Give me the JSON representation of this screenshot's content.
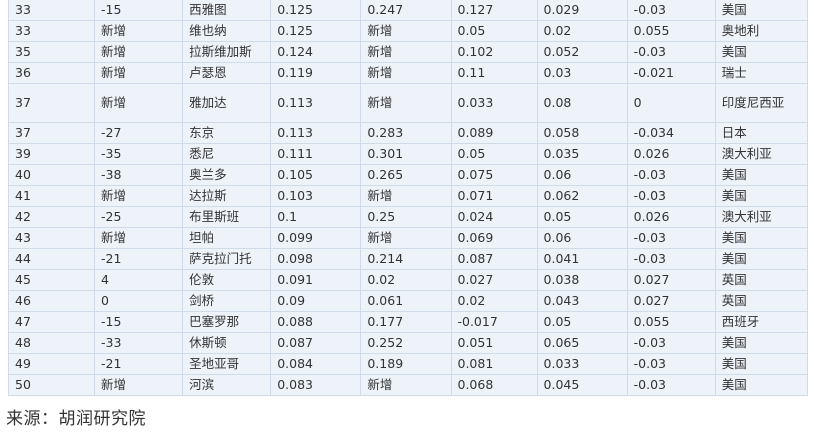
{
  "table": {
    "rows": [
      {
        "rank": "33",
        "change": "-15",
        "city": "西雅图",
        "v1": "0.125",
        "v2": "0.247",
        "v3": "0.127",
        "v4": "0.029",
        "v5": "-0.03",
        "country": "美国"
      },
      {
        "rank": "33",
        "change": "新增",
        "city": "维也纳",
        "v1": "0.125",
        "v2": "新增",
        "v3": "0.05",
        "v4": "0.02",
        "v5": "0.055",
        "country": "奥地利"
      },
      {
        "rank": "35",
        "change": "新增",
        "city": "拉斯维加斯",
        "v1": "0.124",
        "v2": "新增",
        "v3": "0.102",
        "v4": "0.052",
        "v5": "-0.03",
        "country": "美国"
      },
      {
        "rank": "36",
        "change": "新增",
        "city": "卢瑟恩",
        "v1": "0.119",
        "v2": "新增",
        "v3": "0.11",
        "v4": "0.03",
        "v5": "-0.021",
        "country": "瑞士"
      },
      {
        "rank": "37",
        "change": "新增",
        "city": "雅加达",
        "v1": "0.113",
        "v2": "新增",
        "v3": "0.033",
        "v4": "0.08",
        "v5": "0",
        "country": "印度尼西亚"
      },
      {
        "rank": "37",
        "change": "-27",
        "city": "东京",
        "v1": "0.113",
        "v2": "0.283",
        "v3": "0.089",
        "v4": "0.058",
        "v5": "-0.034",
        "country": "日本"
      },
      {
        "rank": "39",
        "change": "-35",
        "city": "悉尼",
        "v1": "0.111",
        "v2": "0.301",
        "v3": "0.05",
        "v4": "0.035",
        "v5": "0.026",
        "country": "澳大利亚"
      },
      {
        "rank": "40",
        "change": "-38",
        "city": "奥兰多",
        "v1": "0.105",
        "v2": "0.265",
        "v3": "0.075",
        "v4": "0.06",
        "v5": "-0.03",
        "country": "美国"
      },
      {
        "rank": "41",
        "change": "新增",
        "city": "达拉斯",
        "v1": "0.103",
        "v2": "新增",
        "v3": "0.071",
        "v4": "0.062",
        "v5": "-0.03",
        "country": "美国"
      },
      {
        "rank": "42",
        "change": "-25",
        "city": "布里斯班",
        "v1": "0.1",
        "v2": "0.25",
        "v3": "0.024",
        "v4": "0.05",
        "v5": "0.026",
        "country": "澳大利亚"
      },
      {
        "rank": "43",
        "change": "新增",
        "city": "坦帕",
        "v1": "0.099",
        "v2": "新增",
        "v3": "0.069",
        "v4": "0.06",
        "v5": "-0.03",
        "country": "美国"
      },
      {
        "rank": "44",
        "change": "-21",
        "city": "萨克拉门托",
        "v1": "0.098",
        "v2": "0.214",
        "v3": "0.087",
        "v4": "0.041",
        "v5": "-0.03",
        "country": "美国"
      },
      {
        "rank": "45",
        "change": "4",
        "city": "伦敦",
        "v1": "0.091",
        "v2": "0.02",
        "v3": "0.027",
        "v4": "0.038",
        "v5": "0.027",
        "country": "英国"
      },
      {
        "rank": "46",
        "change": "0",
        "city": "剑桥",
        "v1": "0.09",
        "v2": "0.061",
        "v3": "0.02",
        "v4": "0.043",
        "v5": "0.027",
        "country": "英国"
      },
      {
        "rank": "47",
        "change": "-15",
        "city": "巴塞罗那",
        "v1": "0.088",
        "v2": "0.177",
        "v3": "-0.017",
        "v4": "0.05",
        "v5": "0.055",
        "country": "西班牙"
      },
      {
        "rank": "48",
        "change": "-33",
        "city": "休斯顿",
        "v1": "0.087",
        "v2": "0.252",
        "v3": "0.051",
        "v4": "0.065",
        "v5": "-0.03",
        "country": "美国"
      },
      {
        "rank": "49",
        "change": "-21",
        "city": "圣地亚哥",
        "v1": "0.084",
        "v2": "0.189",
        "v3": "0.081",
        "v4": "0.033",
        "v5": "-0.03",
        "country": "美国"
      },
      {
        "rank": "50",
        "change": "新增",
        "city": "河滨",
        "v1": "0.083",
        "v2": "新增",
        "v3": "0.068",
        "v4": "0.045",
        "v5": "-0.03",
        "country": "美国"
      }
    ]
  },
  "source": {
    "text": "来源：胡润研究院"
  }
}
